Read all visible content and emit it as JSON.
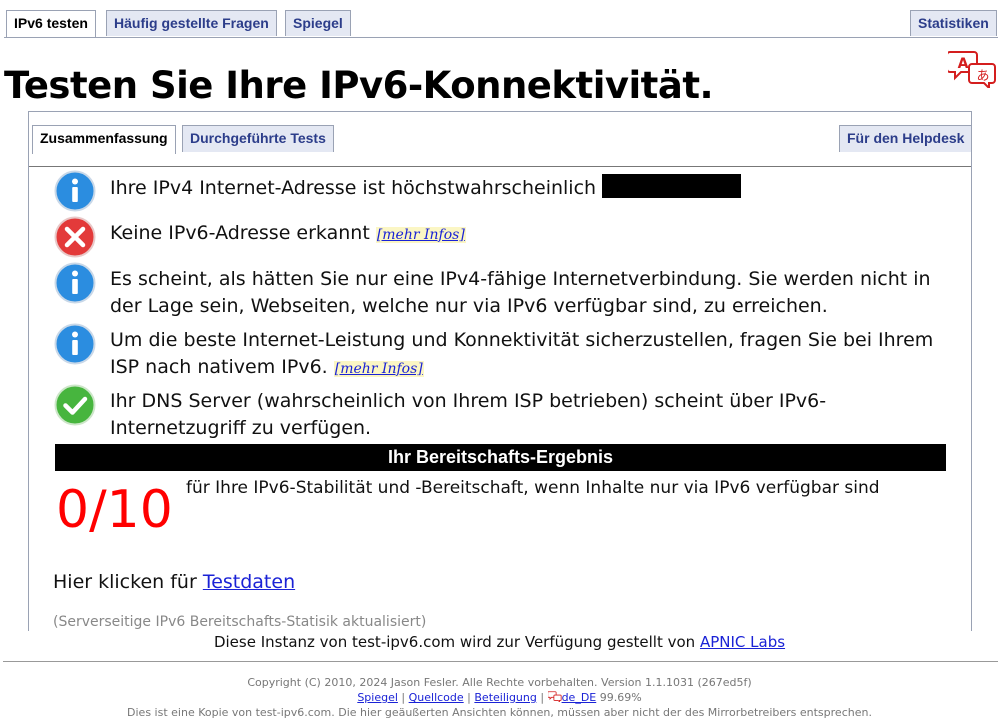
{
  "nav": {
    "tabs": [
      {
        "label": "IPv6 testen",
        "active": true
      },
      {
        "label": "Häufig gestellte Fragen",
        "active": false
      },
      {
        "label": "Spiegel",
        "active": false
      }
    ],
    "right_tab": "Statistiken"
  },
  "page_title": "Testen Sie Ihre IPv6-Konnektivität.",
  "panel_tabs": {
    "summary": "Zusammenfassung",
    "tests": "Durchgeführte Tests",
    "helpdesk": "Für den Helpdesk"
  },
  "results": [
    {
      "icon": "info-icon",
      "text": "Ihre IPv4 Internet-Adresse ist höchstwahrscheinlich"
    },
    {
      "icon": "error-icon",
      "text": "Keine IPv6-Adresse erkannt",
      "more": "[mehr Infos]"
    },
    {
      "icon": "info-icon",
      "text": "Es scheint, als hätten Sie nur eine IPv4-fähige Internetverbindung. Sie werden nicht in der Lage sein, Webseiten, welche nur via IPv6 verfügbar sind, zu erreichen."
    },
    {
      "icon": "info-icon",
      "text": "Um die beste Internet-Leistung und Konnektivität sicherzustellen, fragen Sie bei Ihrem ISP nach nativem IPv6.",
      "more": "[mehr Infos]"
    },
    {
      "icon": "ok-icon",
      "text": "Ihr DNS Server (wahrscheinlich von Ihrem ISP betrieben) scheint über IPv6-Internetzugriff zu verfügen."
    }
  ],
  "readiness": {
    "heading": "Ihr Bereitschafts-Ergebnis",
    "score": "0/10",
    "description": "für Ihre IPv6-Stabilität und -Bereitschaft, wenn Inhalte nur via IPv6 verfügbar sind"
  },
  "testdata": {
    "prefix": "Hier klicken für",
    "link": "Testdaten"
  },
  "stats_note": "(Serverseitige IPv6 Bereitschafts-Statisik aktualisiert)",
  "instance": {
    "text": "Diese Instanz von test-ipv6.com wird zur Verfügung gestellt von",
    "link": "APNIC Labs"
  },
  "footer": {
    "copyright": "Copyright (C) 2010, 2024 Jason Fesler. Alle Rechte vorbehalten. Version 1.1.1031 (267ed5f)",
    "links": [
      "Spiegel",
      "Quellcode",
      "Beteiligung"
    ],
    "locale": "de_DE",
    "locale_pct": "99.69%",
    "disclaimer": "Dies ist eine Kopie von test-ipv6.com. Die hier geäußerten Ansichten können, müssen aber nicht der des Mirrorbetreibers entsprechen."
  },
  "colors": {
    "tab_bg": "#e4e8f3",
    "tab_text": "#2c3d8a",
    "link": "#1a22d6",
    "score": "#ff0000",
    "info": "#2b8de0",
    "error": "#e33a3a",
    "ok": "#47b53e"
  }
}
